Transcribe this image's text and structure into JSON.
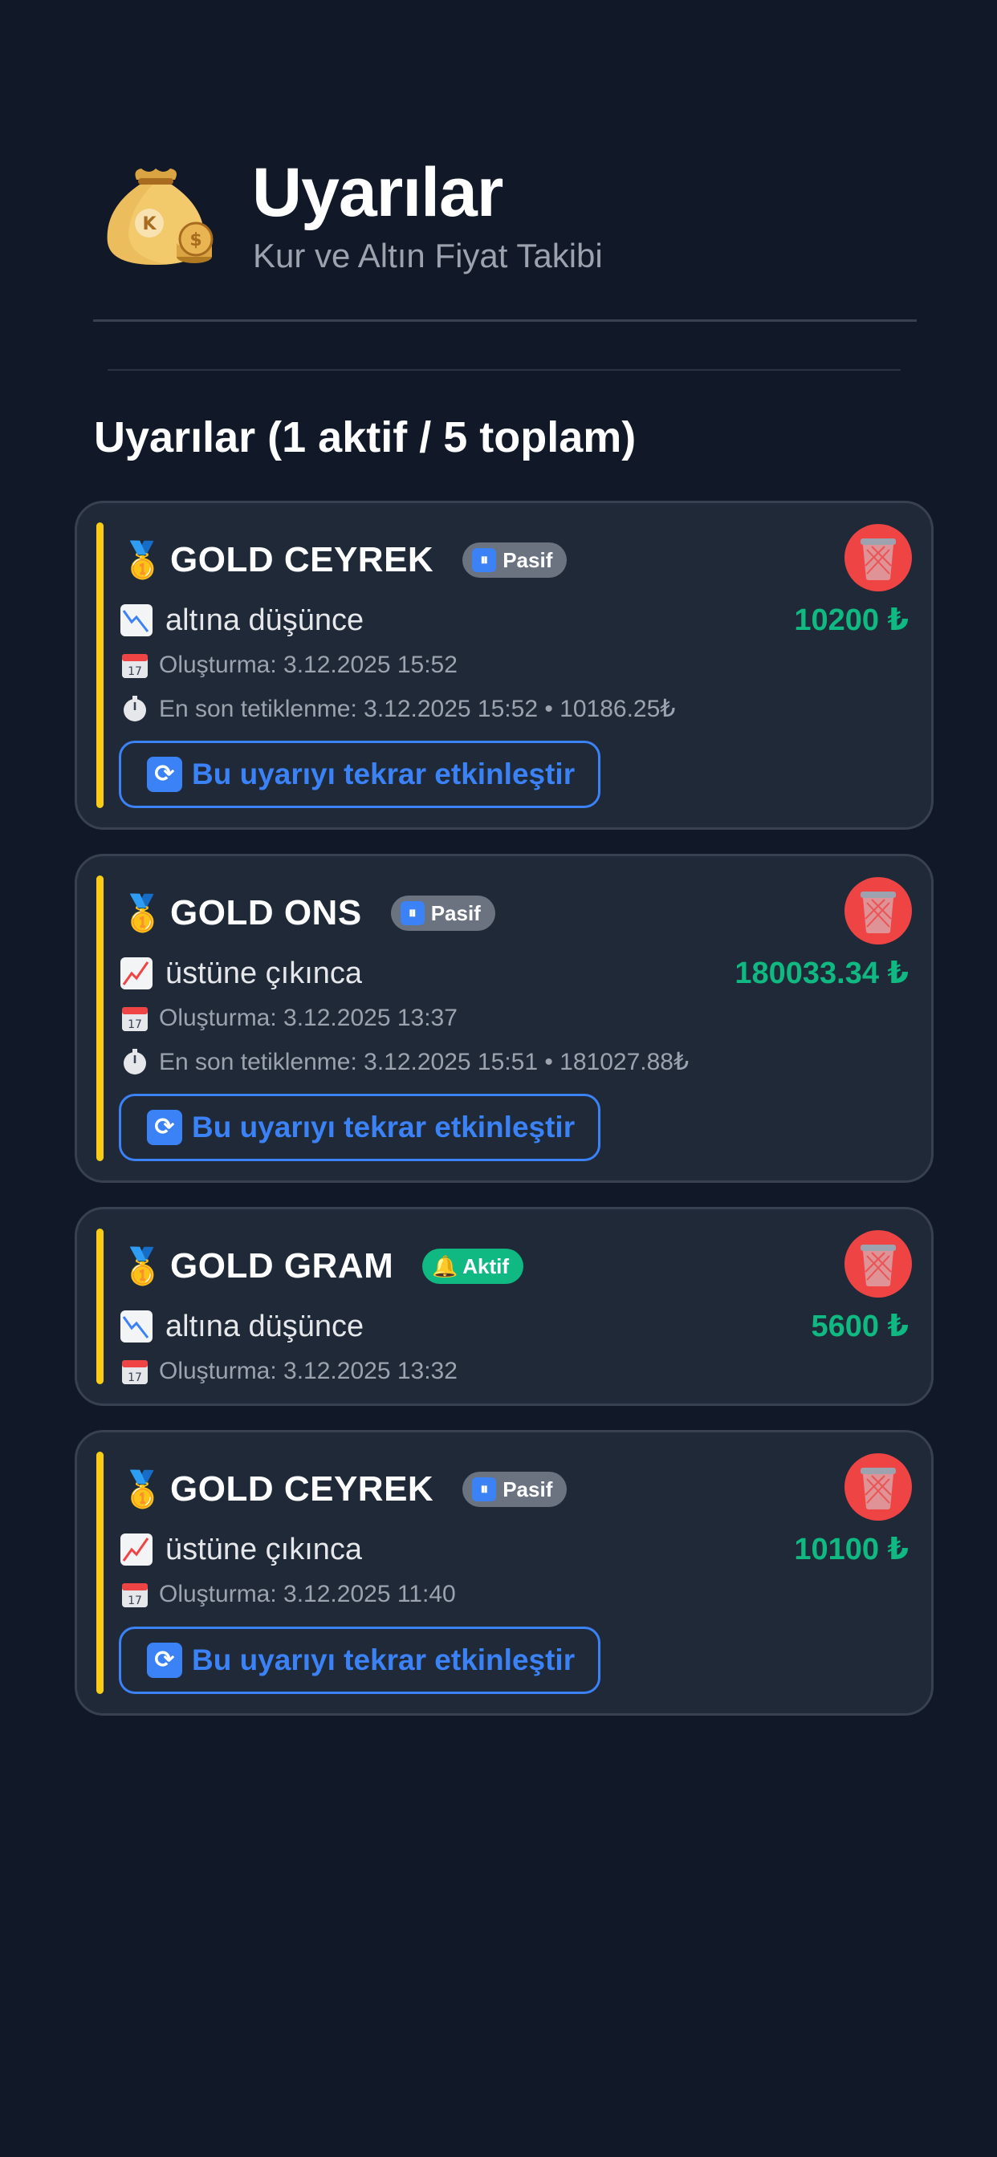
{
  "header": {
    "title": "Uyarılar",
    "subtitle": "Kur ve Altın Fiyat Takibi",
    "logo_icon": "money-bag-icon"
  },
  "section": {
    "title_prefix": "Uyarılar (",
    "active_count": "1 aktif",
    "separator": " / ",
    "total_count": "5 toplam",
    "title_suffix": ")"
  },
  "colors": {
    "background": "#111827",
    "card": "#1f2937",
    "accent": "#facc15",
    "value_green": "#10b981",
    "button_blue": "#3b82f6",
    "delete_red": "#ef4444",
    "badge_gray": "#6b7280"
  },
  "alerts": [
    {
      "name": "GOLD CEYREK",
      "status": "Pasif",
      "condition": "altına düşünce",
      "condition_icon": "chart-down-icon",
      "value": "10200 ₺",
      "created": "Oluşturma: 3.12.2025 15:52",
      "last_triggered": "En son tetiklenme: 3.12.2025 15:52 • 10186.25₺",
      "reactivate_label": "Bu uyarıyı tekrar etkinleştir"
    },
    {
      "name": "GOLD ONS",
      "status": "Pasif",
      "condition": "üstüne çıkınca",
      "condition_icon": "chart-up-icon",
      "value": "180033.34 ₺",
      "created": "Oluşturma: 3.12.2025 13:37",
      "last_triggered": "En son tetiklenme: 3.12.2025 15:51 • 181027.88₺",
      "reactivate_label": "Bu uyarıyı tekrar etkinleştir"
    },
    {
      "name": "GOLD GRAM",
      "status": "Aktif",
      "condition": "altına düşünce",
      "condition_icon": "chart-down-icon",
      "value": "5600 ₺",
      "created": "Oluşturma: 3.12.2025 13:32"
    },
    {
      "name": "GOLD CEYREK",
      "status": "Pasif",
      "condition": "üstüne çıkınca",
      "condition_icon": "chart-up-icon",
      "value": "10100 ₺",
      "created": "Oluşturma: 3.12.2025 11:40",
      "reactivate_label": "Bu uyarıyı tekrar etkinleştir"
    }
  ]
}
